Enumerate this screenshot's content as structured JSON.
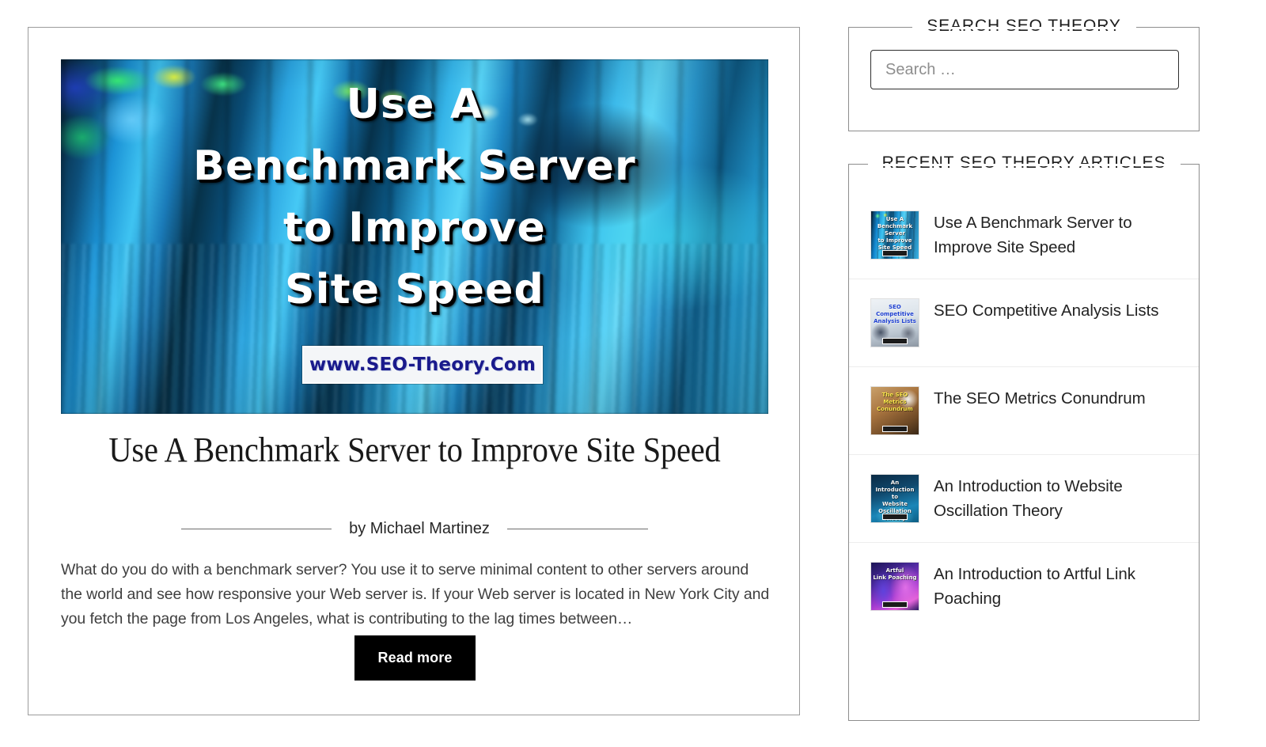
{
  "article": {
    "hero": {
      "overlay_title": "Use A\nBenchmark Server\nto Improve\nSite Speed",
      "url_banner": "www.SEO-Theory.Com",
      "alt_name": "server-racks-photo"
    },
    "title": "Use A Benchmark Server to Improve Site Speed",
    "byline": "by Michael Martinez",
    "excerpt": "What do you do with a benchmark server? You use it to serve minimal content to other servers around the world and see how responsive your Web server is. If your Web server is located in New York City and you fetch the page from Los Angeles, what is contributing to the lag times between…",
    "read_more_label": "Read more"
  },
  "sidebar": {
    "search_widget": {
      "title": "SEARCH SEO THEORY",
      "placeholder": "Search …",
      "value": ""
    },
    "recent_widget": {
      "title": "RECENT SEO THEORY ARTICLES",
      "items": [
        {
          "title": "Use A Benchmark Server to Improve Site Speed",
          "thumb_class": "thumb-benchmark",
          "thumb_text": "Use A\nBenchmark Server\nto Improve\nSite Speed"
        },
        {
          "title": "SEO Competitive Analysis Lists",
          "thumb_class": "thumb-competitive",
          "thumb_text": "SEO\nCompetitive\nAnalysis Lists"
        },
        {
          "title": "The SEO Metrics Conundrum",
          "thumb_class": "thumb-metrics",
          "thumb_text": "The SEO\nMetrics\nConundrum"
        },
        {
          "title": "An Introduction to Website Oscillation Theory",
          "thumb_class": "thumb-oscillation",
          "thumb_text": "An Introduction to\nWebsite Oscillation\nTheory"
        },
        {
          "title": "An Introduction to Artful Link Poaching",
          "thumb_class": "thumb-poaching",
          "thumb_text": "Artful\nLink Poaching"
        }
      ]
    }
  },
  "colors": {
    "page_background": "#ffffff",
    "card_border": "#9b9b9b",
    "button_background": "#000000",
    "button_text": "#ffffff",
    "divider": "#ededed",
    "body_text": "#3f3f3f",
    "heading_text": "#1a1a1a"
  }
}
